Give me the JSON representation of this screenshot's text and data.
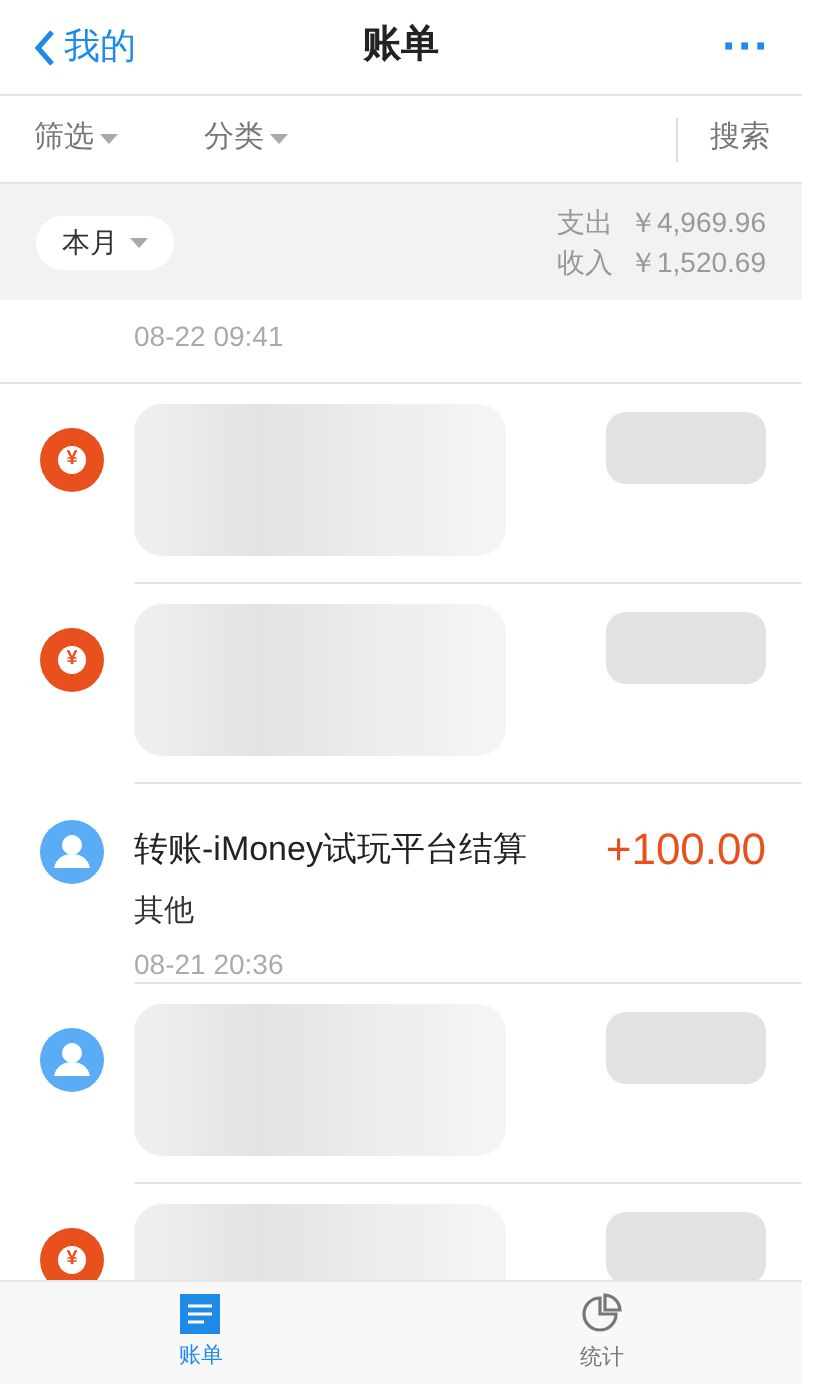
{
  "nav": {
    "back": "我的",
    "title": "账单",
    "more": "···"
  },
  "filters": [
    {
      "label": "筛选"
    },
    {
      "label": "分类"
    }
  ],
  "search": "搜索",
  "summary": {
    "period": "本月",
    "expense_label": "支出",
    "expense": "￥4,969.96",
    "income_label": "收入",
    "income": "￥1,520.69"
  },
  "rows": [
    {
      "kind": "date_only",
      "time": "08-22  09:41"
    },
    {
      "kind": "redacted",
      "icon_label": "¥"
    },
    {
      "kind": "redacted",
      "icon_label": "¥"
    },
    {
      "kind": "entry",
      "title": "转账-iMoney试玩平台结算",
      "amount": "+100.00",
      "category": "其他",
      "time": "08-21  20:36"
    },
    {
      "kind": "redacted"
    },
    {
      "kind": "redacted",
      "icon_label": "¥"
    }
  ],
  "tabs": [
    {
      "label": "账单",
      "selected": true
    },
    {
      "label": "统计",
      "selected": false
    }
  ]
}
